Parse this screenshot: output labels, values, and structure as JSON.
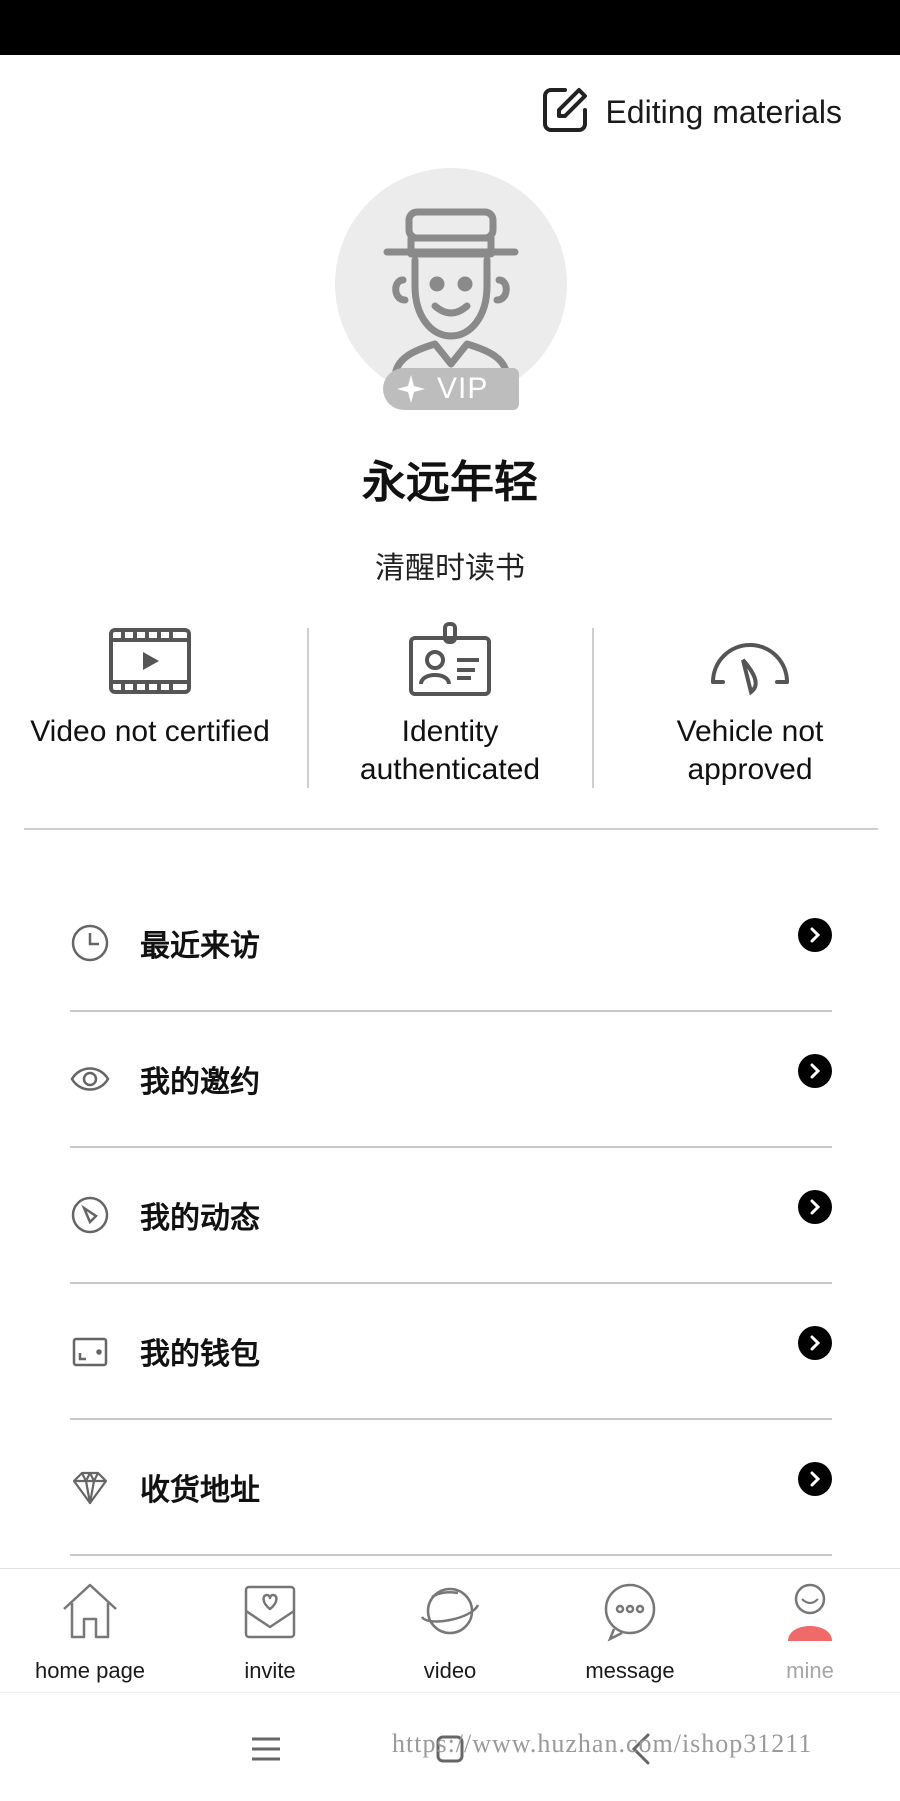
{
  "header": {
    "edit_label": "Editing materials"
  },
  "profile": {
    "vip_label": "VIP",
    "nickname": "永远年轻",
    "signature": "清醒时读书"
  },
  "certifications": [
    {
      "label": "Video not certified",
      "icon": "video-icon"
    },
    {
      "label": "Identity authenticated",
      "icon": "id-card-icon"
    },
    {
      "label": "Vehicle not approved",
      "icon": "dashboard-icon"
    }
  ],
  "menu": [
    {
      "label": "最近来访",
      "icon": "clock-icon"
    },
    {
      "label": "我的邀约",
      "icon": "eye-icon"
    },
    {
      "label": "我的动态",
      "icon": "compass-icon"
    },
    {
      "label": "我的钱包",
      "icon": "wallet-icon"
    },
    {
      "label": "收货地址",
      "icon": "diamond-icon"
    }
  ],
  "tabbar": [
    {
      "label": "home page",
      "icon": "home-icon",
      "active": false
    },
    {
      "label": "invite",
      "icon": "invite-icon",
      "active": false
    },
    {
      "label": "video",
      "icon": "planet-icon",
      "active": false
    },
    {
      "label": "message",
      "icon": "chat-icon",
      "active": false
    },
    {
      "label": "mine",
      "icon": "person-icon",
      "active": true
    }
  ],
  "watermark": "https://www.huzhan.com/ishop31211",
  "colors": {
    "accent": "#f06a6a",
    "text": "#111111",
    "muted": "#a6a6a6"
  }
}
